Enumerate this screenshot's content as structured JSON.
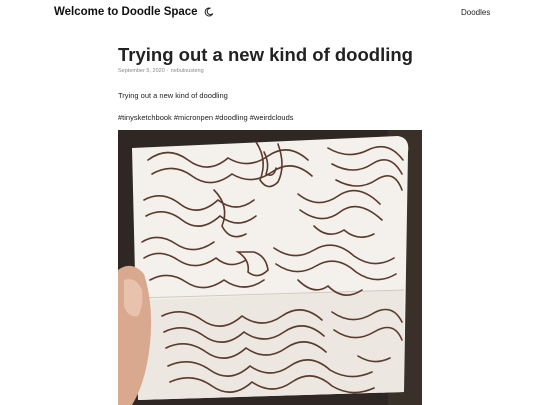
{
  "header": {
    "site_title": "Welcome to Doodle Space",
    "nav_link": "Doodles"
  },
  "post": {
    "title": "Trying out a new kind of doodling",
    "date": "September 5, 2020",
    "separator": "·",
    "author": "nebulousteng",
    "body_text": "Trying out a new kind of doodling",
    "hashtags": "#tinysketchbook #micronpen #doodling #weirdclouds",
    "image_alt": "Photo of a tiny sketchbook with wavy cloud-like pen doodles held in a hand"
  },
  "colors": {
    "accent_text": "#222222",
    "meta_text": "#888888",
    "ink": "#5a3a2c",
    "paper": "#f4f1ec"
  }
}
